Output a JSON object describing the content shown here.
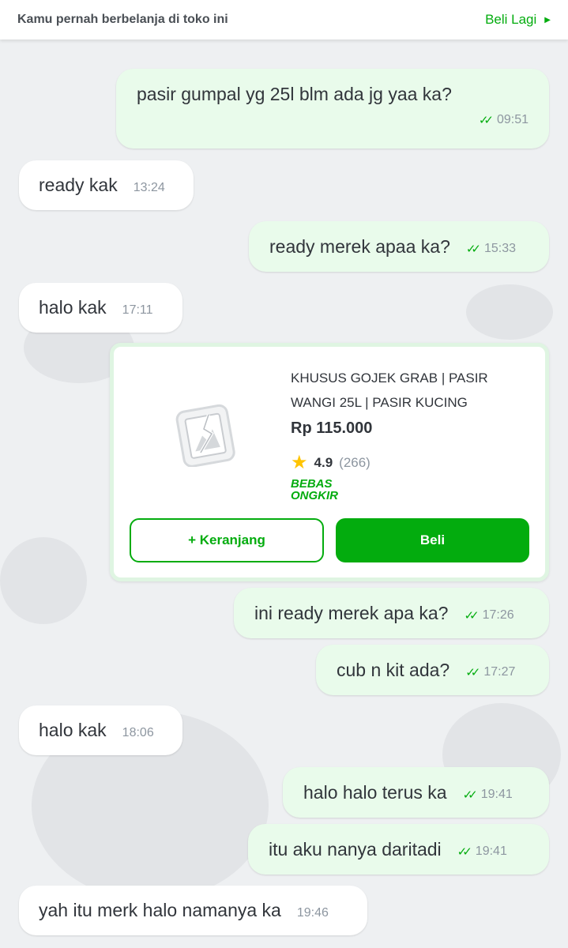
{
  "header": {
    "info_text": "Kamu pernah berbelanja di toko ini",
    "action_label": "Beli Lagi"
  },
  "messages": [
    {
      "from": "me",
      "text": "pasir gumpal yg 25l blm ada jg yaa ka?",
      "time": "09:51",
      "status": "read"
    },
    {
      "from": "seller",
      "text": "ready kak",
      "time": "13:24"
    },
    {
      "from": "me",
      "text": "ready merek apaa ka?",
      "time": "15:33",
      "status": "read"
    },
    {
      "from": "seller",
      "text": "halo kak",
      "time": "17:11"
    },
    {
      "from": "me",
      "text": "ini ready merek apa ka?",
      "time": "17:26",
      "status": "read"
    },
    {
      "from": "me",
      "text": "cub n kit ada?",
      "time": "17:27",
      "status": "read"
    },
    {
      "from": "seller",
      "text": "halo kak",
      "time": "18:06"
    },
    {
      "from": "me",
      "text": "halo halo terus ka",
      "time": "19:41",
      "status": "read"
    },
    {
      "from": "me",
      "text": "itu aku nanya daritadi",
      "time": "19:41",
      "status": "read"
    },
    {
      "from": "seller",
      "text": "yah itu merk halo namanya ka",
      "time": "19:46"
    }
  ],
  "product_card": {
    "name": "KHUSUS GOJEK GRAB | PASIR WANGI 25L | PASIR KUCING",
    "price": "Rp 115.000",
    "rating": "4.9",
    "review_count": "(266)",
    "shipping_badge_line1": "BEBAS",
    "shipping_badge_line2": "ONGKIR",
    "cart_button_label": "+ Keranjang",
    "buy_button_label": "Beli",
    "image_icon": "broken-image-icon"
  },
  "colors": {
    "accent": "#03ac0e",
    "outgoing_bubble": "#e9fbeb",
    "incoming_bubble": "#ffffff",
    "background": "#eef0f2"
  }
}
